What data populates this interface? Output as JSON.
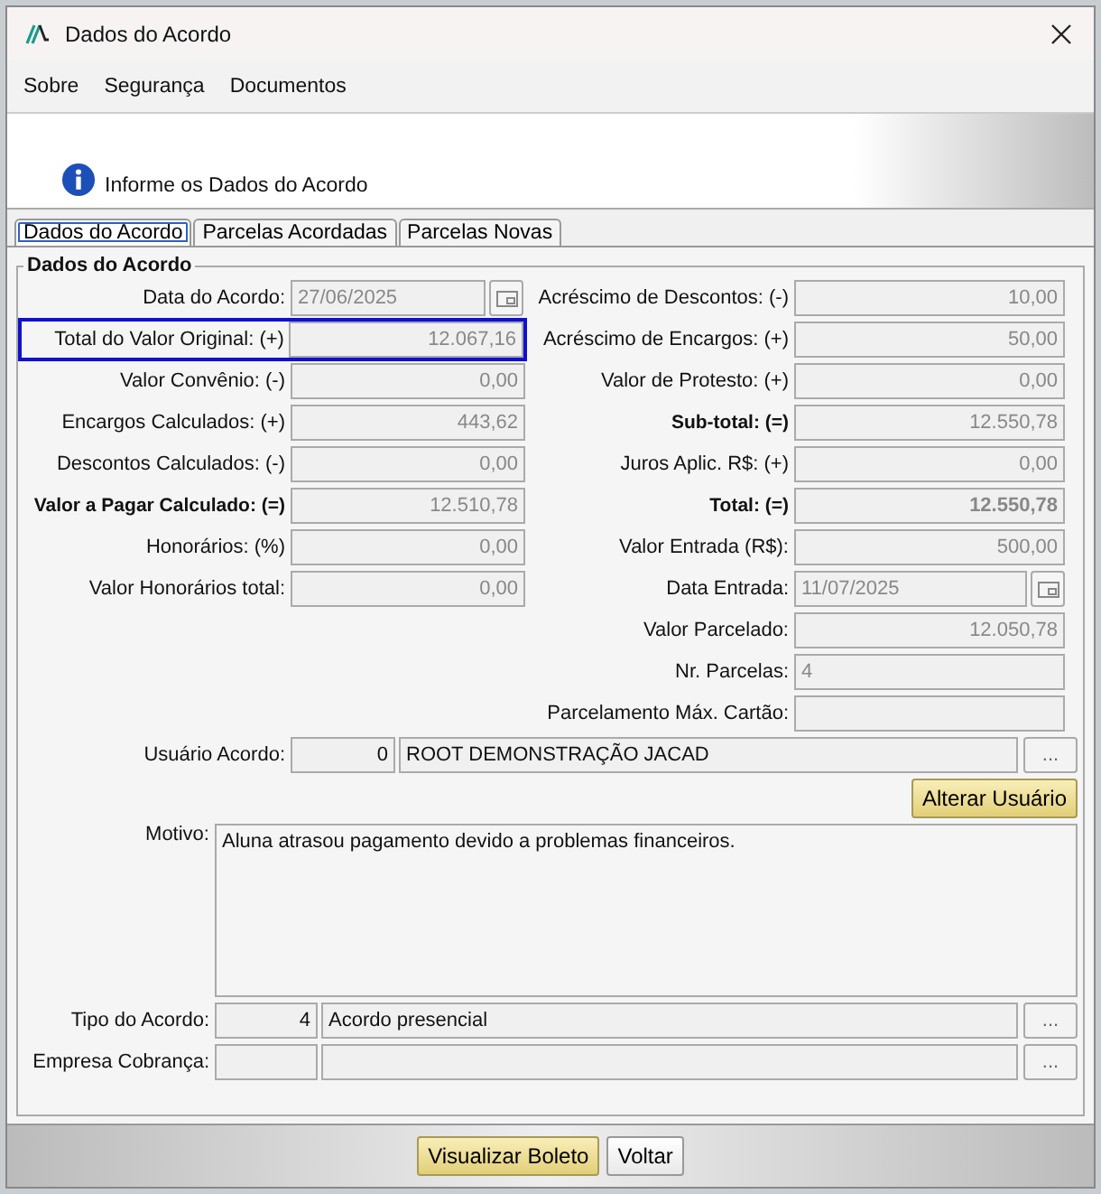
{
  "window": {
    "title": "Dados do Acordo"
  },
  "menu": [
    "Sobre",
    "Segurança",
    "Documentos"
  ],
  "banner": {
    "text": "Informe os Dados do Acordo"
  },
  "tabs": [
    {
      "label": "Dados do Acordo",
      "selected": true
    },
    {
      "label": "Parcelas Acordadas",
      "selected": false
    },
    {
      "label": "Parcelas Novas",
      "selected": false
    }
  ],
  "group": {
    "title": "Dados do Acordo"
  },
  "left_fields": [
    {
      "label": "Data do Acordo:",
      "value": "27/06/2025",
      "kind": "date",
      "bold": false,
      "highlighted": false
    },
    {
      "label": "Total do Valor Original: (+)",
      "value": "12.067,16",
      "kind": "amount",
      "bold": false,
      "highlighted": true
    },
    {
      "label": "Valor Convênio: (-)",
      "value": "0,00",
      "kind": "amount",
      "bold": false,
      "highlighted": false
    },
    {
      "label": "Encargos Calculados: (+)",
      "value": "443,62",
      "kind": "amount",
      "bold": false,
      "highlighted": false
    },
    {
      "label": "Descontos Calculados: (-)",
      "value": "0,00",
      "kind": "amount",
      "bold": false,
      "highlighted": false
    },
    {
      "label": "Valor a Pagar Calculado: (=)",
      "value": "12.510,78",
      "kind": "amount",
      "bold": true,
      "highlighted": false
    },
    {
      "label": "Honorários: (%)",
      "value": "0,00",
      "kind": "amount",
      "bold": false,
      "highlighted": false
    },
    {
      "label": "Valor Honorários total:",
      "value": "0,00",
      "kind": "amount",
      "bold": false,
      "highlighted": false
    }
  ],
  "right_fields": [
    {
      "label": "Acréscimo de Descontos: (-)",
      "value": "10,00",
      "kind": "amount",
      "bold": false
    },
    {
      "label": "Acréscimo de Encargos: (+)",
      "value": "50,00",
      "kind": "amount",
      "bold": false
    },
    {
      "label": "Valor de Protesto: (+)",
      "value": "0,00",
      "kind": "amount",
      "bold": false
    },
    {
      "label": "Sub-total: (=)",
      "value": "12.550,78",
      "kind": "amount",
      "bold": true
    },
    {
      "label": "Juros Aplic. R$: (+)",
      "value": "0,00",
      "kind": "amount",
      "bold": false
    },
    {
      "label": "Total: (=)",
      "value": "12.550,78",
      "kind": "total",
      "bold": true
    },
    {
      "label": "Valor Entrada (R$):",
      "value": "500,00",
      "kind": "amount",
      "bold": false
    },
    {
      "label": "Data Entrada:",
      "value": "11/07/2025",
      "kind": "date",
      "bold": false
    },
    {
      "label": "Valor Parcelado:",
      "value": "12.050,78",
      "kind": "amount",
      "bold": false
    },
    {
      "label": "Nr. Parcelas:",
      "value": "4",
      "kind": "text",
      "bold": false
    },
    {
      "label": "Parcelamento Máx. Cartão:",
      "kind": "text",
      "bold": false
    }
  ],
  "user": {
    "label": "Usuário Acordo:",
    "code": "0",
    "name": "ROOT DEMONSTRAÇÃO JACAD",
    "button": "...",
    "action": "Alterar Usuário"
  },
  "reason": {
    "label": "Motivo:",
    "value": "Aluna atrasou pagamento devido a problemas financeiros."
  },
  "lookups": [
    {
      "label": "Tipo do Acordo:",
      "code": "4",
      "name": "Acordo presencial",
      "button": "..."
    },
    {
      "label": "Empresa Cobrança:",
      "button": "..."
    }
  ],
  "buttons": [
    {
      "label": "Visualizar Boleto",
      "kind": "primary"
    },
    {
      "label": "Voltar",
      "kind": "secondary"
    }
  ]
}
